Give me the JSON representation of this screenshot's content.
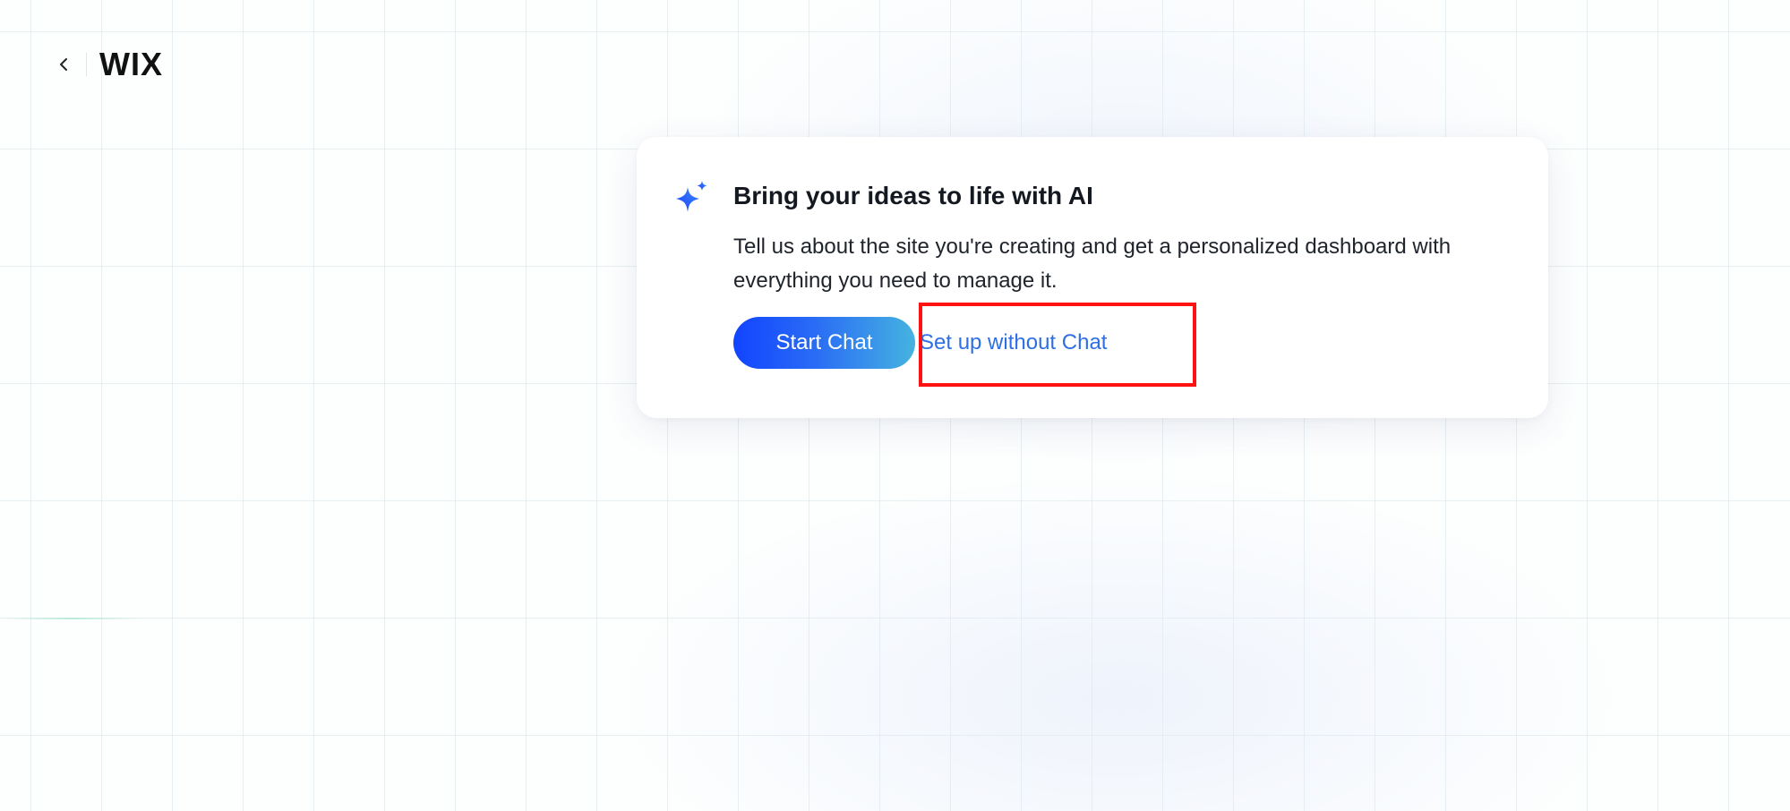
{
  "header": {
    "back_icon": "chevron-left-icon",
    "logo_text": "WIX"
  },
  "card": {
    "icon": "sparkle-icon",
    "title": "Bring your ideas to life with AI",
    "description": "Tell us about the site you're creating and get a personalized dashboard with everything you need to manage it.",
    "primary_button_label": "Start Chat",
    "secondary_button_label": "Set up without Chat"
  },
  "colors": {
    "primary_gradient_start": "#1144ff",
    "primary_gradient_end": "#45b3e0",
    "link_blue": "#2f6fe4",
    "highlight_red": "#ff1212"
  }
}
